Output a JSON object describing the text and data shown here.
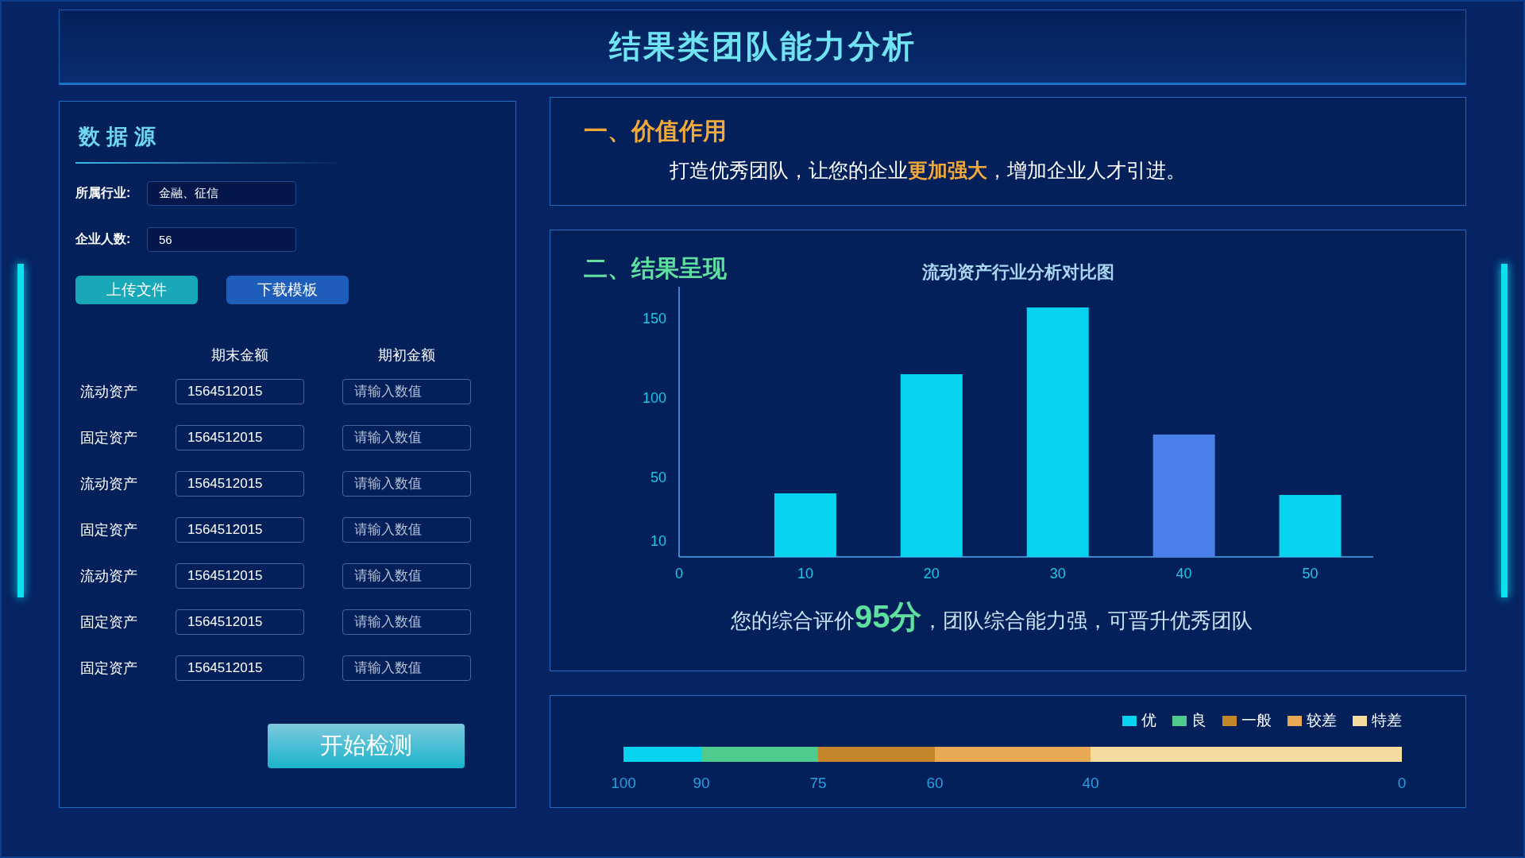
{
  "header": {
    "title": "结果类团队能力分析"
  },
  "data_source": {
    "title": "数据源",
    "fields": [
      {
        "label": "所属行业:",
        "value": "金融、征信"
      },
      {
        "label": "企业人数:",
        "value": "56"
      }
    ],
    "buttons": [
      {
        "label": "上传文件",
        "kind": "upload"
      },
      {
        "label": "下载模板",
        "kind": "download"
      }
    ],
    "table": {
      "columns": [
        "期末金额",
        "期初金额"
      ],
      "rows": [
        {
          "label": "流动资产",
          "end_value": "1564512015",
          "start_placeholder": "请输入数值"
        },
        {
          "label": "固定资产",
          "end_value": "1564512015",
          "start_placeholder": "请输入数值"
        },
        {
          "label": "流动资产",
          "end_value": "1564512015",
          "start_placeholder": "请输入数值"
        },
        {
          "label": "固定资产",
          "end_value": "1564512015",
          "start_placeholder": "请输入数值"
        },
        {
          "label": "流动资产",
          "end_value": "1564512015",
          "start_placeholder": "请输入数值"
        },
        {
          "label": "固定资产",
          "end_value": "1564512015",
          "start_placeholder": "请输入数值"
        },
        {
          "label": "固定资产",
          "end_value": "1564512015",
          "start_placeholder": "请输入数值"
        }
      ]
    },
    "start_button": "开始检测"
  },
  "value_section": {
    "heading": "一、价值作用",
    "text": "打造优秀团队，让您的企业**更加强大**，增加企业人才引进。"
  },
  "result_section": {
    "heading": "二、结果呈现",
    "chart_data": {
      "type": "bar",
      "title": "流动资产行业分析对比图",
      "x": [
        10,
        20,
        30,
        40,
        50
      ],
      "xlim": [
        0,
        55
      ],
      "xticks": [
        0,
        10,
        20,
        30,
        40,
        50
      ],
      "ylim": [
        0,
        170
      ],
      "yticks": [
        10,
        50,
        100,
        150
      ],
      "series": [
        {
          "color": "#06d3ef",
          "values": [
            40,
            115,
            157,
            null,
            39
          ]
        },
        {
          "color": "#4a80e8",
          "values": [
            null,
            null,
            null,
            77,
            null
          ]
        }
      ]
    },
    "summary": {
      "prefix": "您的综合评价",
      "score": "95分",
      "suffix": "，团队综合能力强，可晋升优秀团队"
    }
  },
  "rating_scale": {
    "legend": [
      {
        "label": "优",
        "color": "#06d3ef"
      },
      {
        "label": "良",
        "color": "#4fcb8d"
      },
      {
        "label": "一般",
        "color": "#c4862b"
      },
      {
        "label": "较差",
        "color": "#e8a955"
      },
      {
        "label": "特差",
        "color": "#f4dc9e"
      }
    ],
    "ticks": [
      "100",
      "90",
      "75",
      "60",
      "40",
      "0"
    ]
  }
}
